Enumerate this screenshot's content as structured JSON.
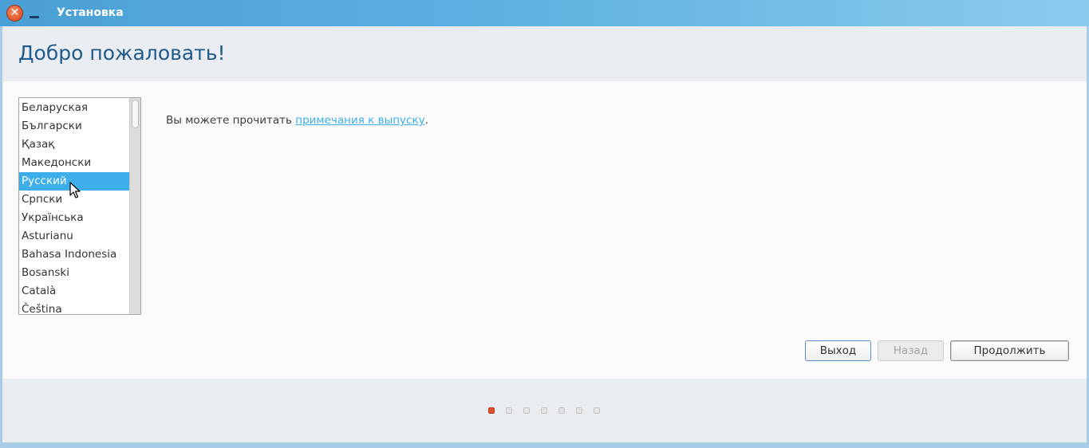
{
  "window": {
    "title": "Установка",
    "close_glyph": "✕"
  },
  "header": {
    "title": "Добро пожаловать!"
  },
  "languages": {
    "selected_index": 4,
    "items": [
      "Беларуская",
      "Български",
      "Қазақ",
      "Македонски",
      "Русский",
      "Српски",
      "Українська",
      "Asturianu",
      "Bahasa Indonesia",
      "Bosanski",
      "Català",
      "Čeština"
    ]
  },
  "release": {
    "prefix": "Вы можете прочитать ",
    "link": "примечания к выпуску",
    "suffix": "."
  },
  "buttons": {
    "exit": "Выход",
    "back": "Назад",
    "continue": "Продолжить"
  },
  "progress": {
    "total_steps": 7,
    "current_step": 1
  },
  "colors": {
    "accent": "#3daee9",
    "active_dot": "#e0502a",
    "title": "#1f5a8c"
  },
  "icons": {
    "close": "close-icon",
    "minimize": "minimize-icon",
    "cursor": "mouse-pointer-icon"
  }
}
